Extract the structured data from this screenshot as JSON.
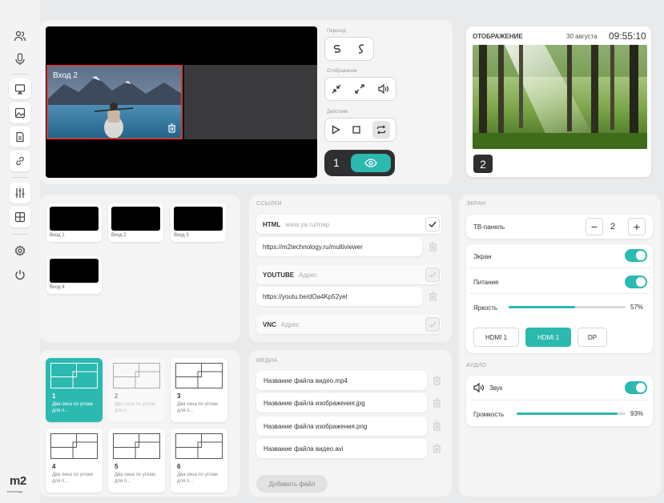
{
  "preview": {
    "input2_label": "Вход 2"
  },
  "controls": {
    "transition_label": "Переход",
    "display_label": "Отображение",
    "action_label": "Действие",
    "screen_number": "1"
  },
  "display": {
    "title": "ОТОБРАЖЕНИЕ",
    "date": "30 августа",
    "time": "09:55:10",
    "screen_badge": "2"
  },
  "inputs": [
    {
      "label": "Вход 1"
    },
    {
      "label": "Вход 2"
    },
    {
      "label": "Вход 3"
    },
    {
      "label": "Вход 4"
    }
  ],
  "layouts": [
    {
      "num": "1",
      "desc": "Два окна по углам для п..."
    },
    {
      "num": "2",
      "desc": "Два окна по углам для п..."
    },
    {
      "num": "3",
      "desc": "Два окна по углам для п..."
    },
    {
      "num": "4",
      "desc": "Два окна по углам для п..."
    },
    {
      "num": "5",
      "desc": "Два окна по углам для п..."
    },
    {
      "num": "6",
      "desc": "Два окна по углам для п..."
    }
  ],
  "links": {
    "section_label": "ССЫЛКИ",
    "html_kind": "HTML",
    "html_placeholder": "www.ya.ru/map",
    "html_value": "https://m2technology.ru/multiviewer",
    "youtube_kind": "YOUTUBE",
    "youtube_placeholder": "Адрес",
    "youtube_value": "https://youtu.be/dOa4Kp52yel",
    "vnc_kind": "VNC",
    "vnc_placeholder": "Адрес"
  },
  "media": {
    "section_label": "МЕДИА",
    "files": [
      "Название файла видео.mp4",
      "Название файла изображения.jpg",
      "Название файла изображения.png",
      "Название файла видео.avi"
    ],
    "add_label": "Добавить файл"
  },
  "screen": {
    "section_label": "ЭКРАН",
    "tv_label": "ТВ-панель",
    "tv_value": "2",
    "screen_label": "Экран",
    "power_label": "Питание",
    "brightness_label": "Яркость",
    "brightness_value": "57%",
    "brightness_level": 0.57,
    "sources": [
      "HDMI 1",
      "HDMI 1",
      "DP"
    ]
  },
  "audio": {
    "section_label": "АУДИО",
    "sound_label": "Звук",
    "volume_label": "Громкость",
    "volume_value": "93%",
    "volume_level": 0.93
  },
  "colors": {
    "accent": "#2bb9b0",
    "selection_border": "#d33b3b",
    "dark": "#2f2f31"
  }
}
